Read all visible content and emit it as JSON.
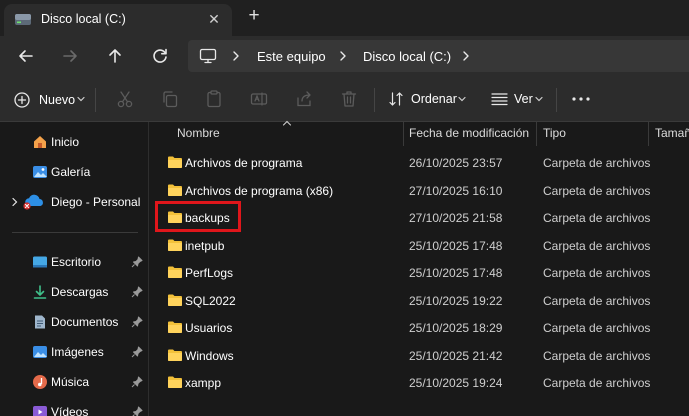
{
  "tab": {
    "title": "Disco local (C:)",
    "close_glyph": "✕",
    "new_tab_glyph": "+"
  },
  "nav": {
    "back": "arrow-left-icon",
    "forward": "arrow-right-icon",
    "up": "arrow-up-icon",
    "refresh": "refresh-icon"
  },
  "address": {
    "breadcrumbs": [
      "Este equipo",
      "Disco local (C:)"
    ]
  },
  "toolbar": {
    "new_label": "Nuevo",
    "sort_label": "Ordenar",
    "view_label": "Ver",
    "more_glyph": "•••",
    "icons": [
      "cut-icon",
      "copy-icon",
      "paste-icon",
      "rename-icon",
      "share-icon",
      "delete-icon"
    ]
  },
  "sidebar": {
    "items": [
      {
        "label": "Inicio",
        "icon": "home-icon"
      },
      {
        "label": "Galería",
        "icon": "gallery-icon"
      },
      {
        "label": "Diego - Personal",
        "icon": "onedrive-icon"
      }
    ],
    "quick_access": [
      {
        "label": "Escritorio",
        "icon": "desktop-icon"
      },
      {
        "label": "Descargas",
        "icon": "download-icon"
      },
      {
        "label": "Documentos",
        "icon": "documents-icon"
      },
      {
        "label": "Imágenes",
        "icon": "pictures-icon"
      },
      {
        "label": "Música",
        "icon": "music-icon"
      },
      {
        "label": "Vídeos",
        "icon": "videos-icon"
      }
    ]
  },
  "columns": {
    "name": "Nombre",
    "modified": "Fecha de modificación",
    "type": "Tipo",
    "size": "Tamañ"
  },
  "files": [
    {
      "name": "Archivos de programa",
      "modified": "26/10/2025 23:57",
      "type": "Carpeta de archivos"
    },
    {
      "name": "Archivos de programa (x86)",
      "modified": "27/10/2025 16:10",
      "type": "Carpeta de archivos"
    },
    {
      "name": "backups",
      "modified": "27/10/2025 21:58",
      "type": "Carpeta de archivos"
    },
    {
      "name": "inetpub",
      "modified": "25/10/2025 17:48",
      "type": "Carpeta de archivos"
    },
    {
      "name": "PerfLogs",
      "modified": "25/10/2025 17:48",
      "type": "Carpeta de archivos"
    },
    {
      "name": "SQL2022",
      "modified": "25/10/2025 19:22",
      "type": "Carpeta de archivos"
    },
    {
      "name": "Usuarios",
      "modified": "25/10/2025 18:29",
      "type": "Carpeta de archivos"
    },
    {
      "name": "Windows",
      "modified": "25/10/2025 21:42",
      "type": "Carpeta de archivos"
    },
    {
      "name": "xampp",
      "modified": "25/10/2025 19:24",
      "type": "Carpeta de archivos"
    }
  ],
  "colors": {
    "folder": "#f3c13a",
    "highlight_box": "#e0161b",
    "accent": "#4cc2ff"
  }
}
